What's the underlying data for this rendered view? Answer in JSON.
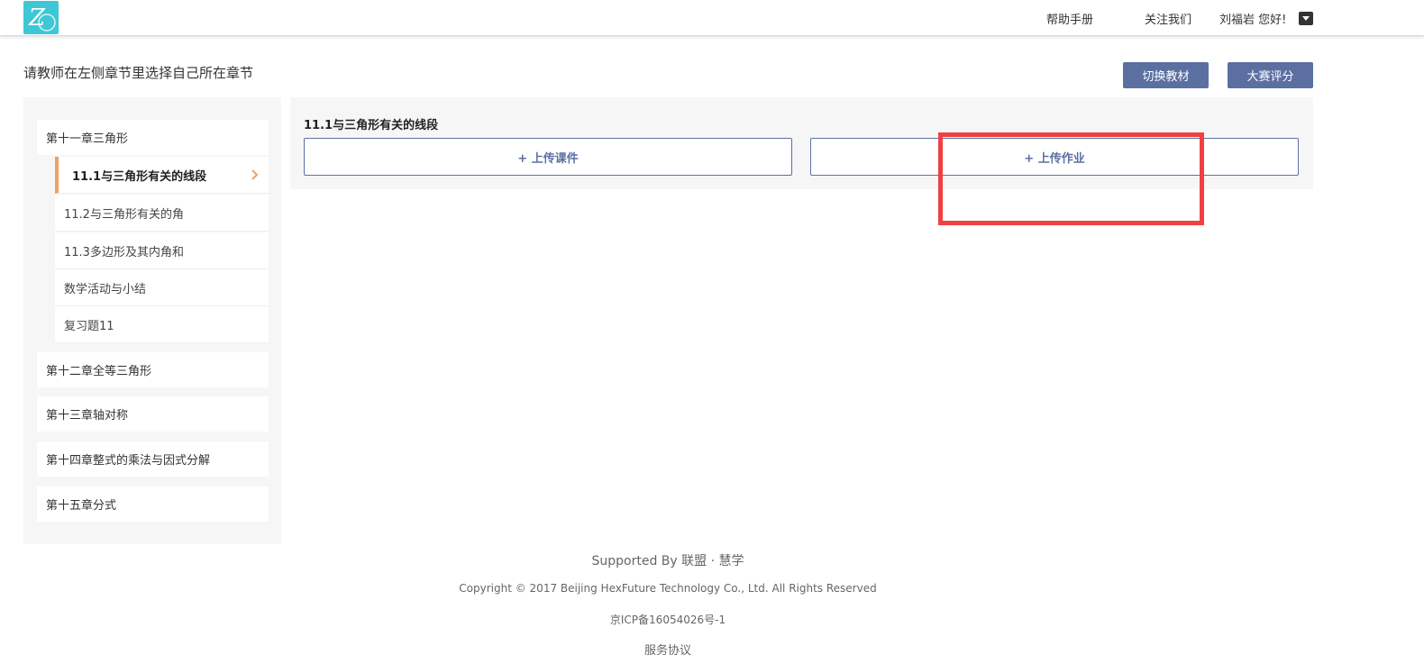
{
  "header": {
    "logo_letter": "Z",
    "help_manual": "帮助手册",
    "follow_us": "关注我们",
    "greeting": "刘福岩 您好!"
  },
  "top": {
    "instruction": "请教师在左侧章节里选择自己所在章节",
    "switch_textbook": "切换教材",
    "contest_scoring": "大赛评分"
  },
  "sidebar": {
    "chapters": [
      {
        "label": "第十一章三角形"
      },
      {
        "label": "第十二章全等三角形"
      },
      {
        "label": "第十三章轴对称"
      },
      {
        "label": "第十四章整式的乘法与因式分解"
      },
      {
        "label": "第十五章分式"
      }
    ],
    "sections": [
      {
        "label": "11.1与三角形有关的线段",
        "active": true
      },
      {
        "label": "11.2与三角形有关的角"
      },
      {
        "label": "11.3多边形及其内角和"
      },
      {
        "label": "数学活动与小结"
      },
      {
        "label": "复习题11"
      }
    ]
  },
  "content": {
    "title": "11.1与三角形有关的线段",
    "upload_courseware": "+ 上传课件",
    "upload_homework": "+ 上传作业"
  },
  "footer": {
    "supported_by": "Supported By 联盟 · 慧学",
    "copyright": "Copyright © 2017 Beijing HexFuture Technology Co., Ltd. All Rights Reserved",
    "icp": "京ICP备16054026号-1",
    "service_agreement": "服务协议"
  },
  "colors": {
    "accent": "#5b6fa1",
    "active_marker": "#f0a060",
    "highlight": "#f04040",
    "logo_bg": "#3ec7d4"
  }
}
